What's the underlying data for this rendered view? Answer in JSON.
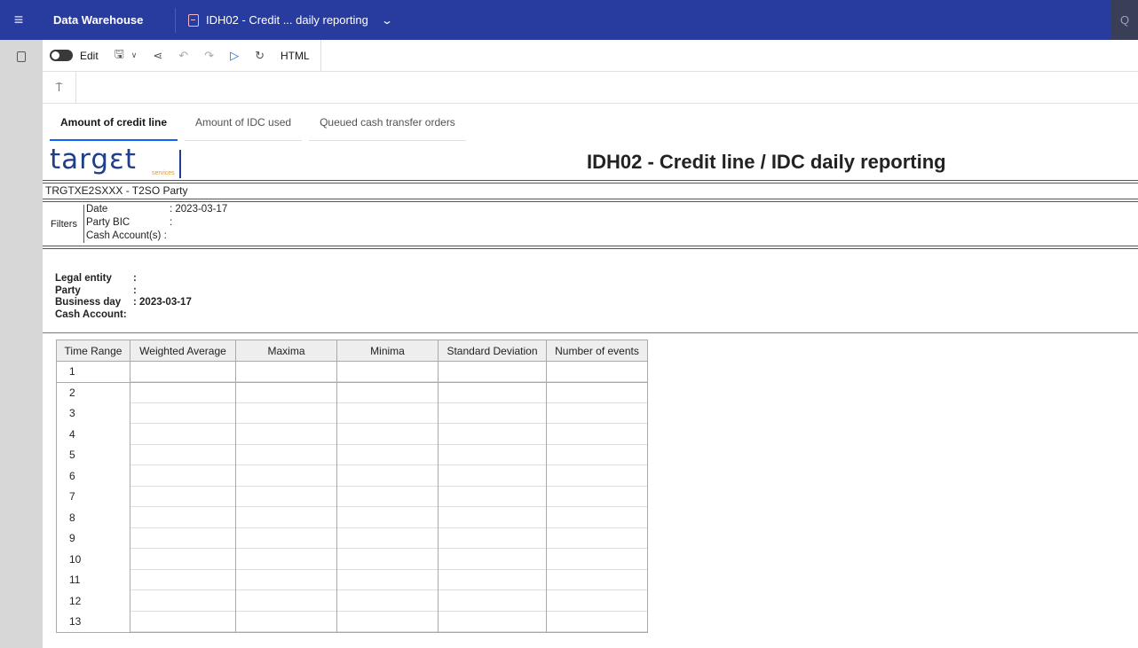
{
  "topbar": {
    "menu_icon": "hamburger-icon",
    "app_name": "Data Warehouse",
    "report_tab_label": "IDH02 - Credit ... daily reporting",
    "report_icon": "clipboard-icon",
    "dropdown_icon": "chevron-down-icon",
    "search_icon": "search-icon",
    "search_glyph": "Q"
  },
  "toolbar": {
    "edit_label": "Edit",
    "html_label": "HTML"
  },
  "tabs": [
    {
      "label": "Amount of credit line",
      "active": true
    },
    {
      "label": "Amount of IDC used",
      "active": false
    },
    {
      "label": "Queued cash transfer orders",
      "active": false
    }
  ],
  "report": {
    "logo_text": "targεt",
    "logo_sub": "services",
    "title": "IDH02 - Credit line / IDC daily reporting",
    "party_line": "TRGTXE2SXXX - T2SO Party",
    "filters_label": "Filters",
    "filters": [
      {
        "key": "Date",
        "value": ": 2023-03-17"
      },
      {
        "key": "Party BIC",
        "value": ":"
      },
      {
        "key": "Cash Account(s) :",
        "value": ""
      }
    ],
    "info": [
      {
        "key": "Legal entity",
        "value": ":"
      },
      {
        "key": "Party",
        "value": ":"
      },
      {
        "key": "Business day",
        "value": ": 2023-03-17"
      },
      {
        "key": "Cash Account",
        "value": ":"
      }
    ]
  },
  "table": {
    "headers": [
      "Time Range",
      "Weighted Average",
      "Maxima",
      "Minima",
      "Standard Deviation",
      "Number of events"
    ],
    "rows": [
      "1",
      "2",
      "3",
      "4",
      "5",
      "6",
      "7",
      "8",
      "9",
      "10",
      "11",
      "12",
      "13"
    ]
  },
  "colors": {
    "topbar_bg": "#283ca0",
    "accent": "#0f62fe",
    "logo_blue": "#1f3f8c",
    "logo_orange": "#e59a2b"
  }
}
